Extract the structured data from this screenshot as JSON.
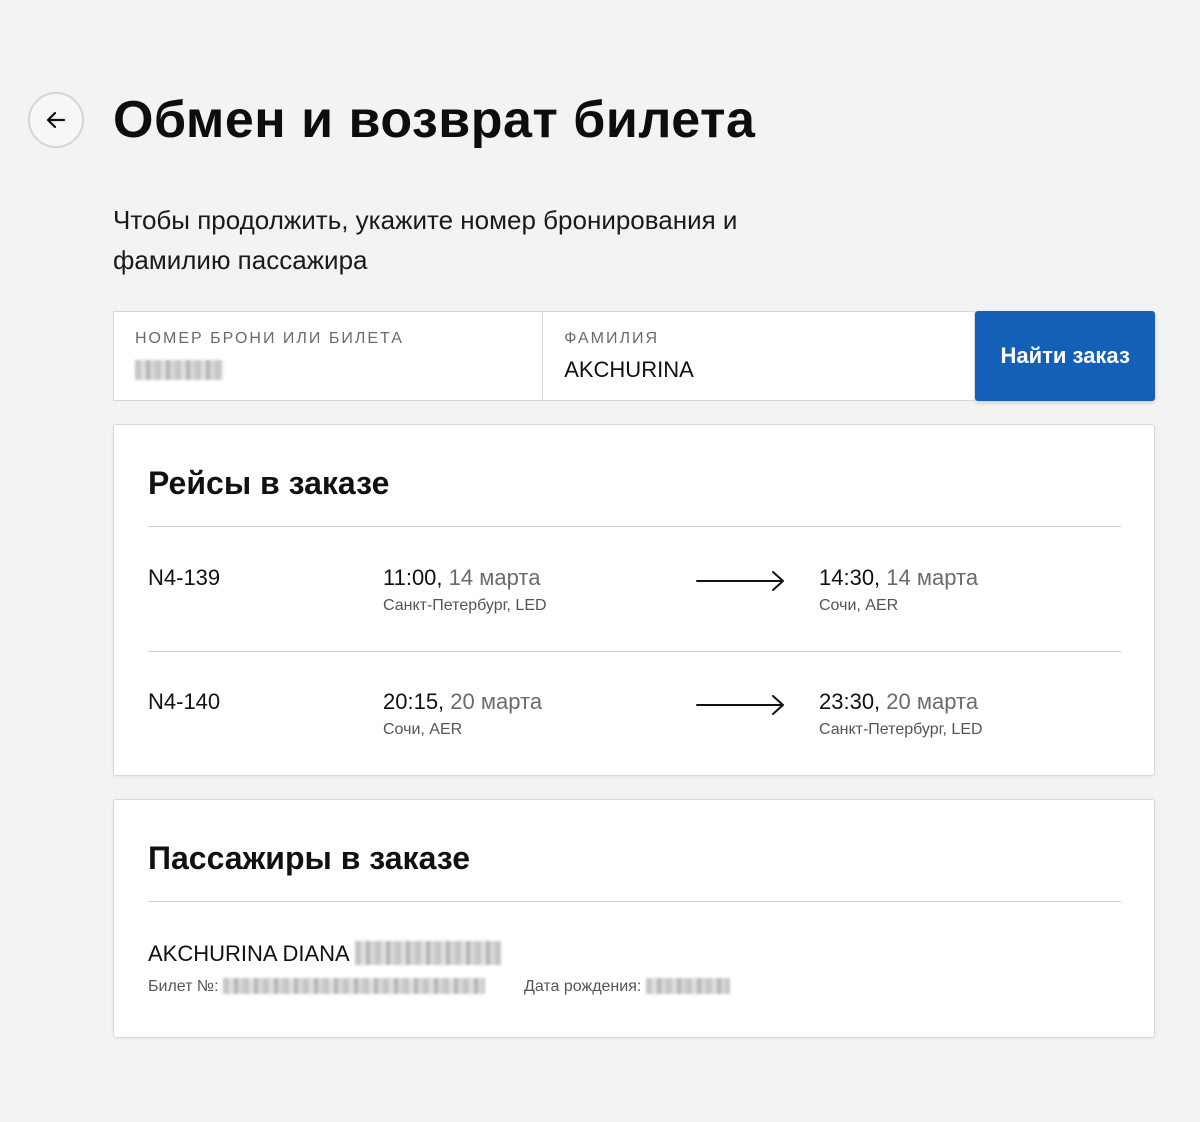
{
  "page": {
    "title": "Обмен и возврат билета",
    "intro": "Чтобы продолжить, укажите номер бронирования и фамилию пассажира"
  },
  "icons": {
    "back": "arrow-left-icon",
    "flight_arrow": "arrow-right-icon"
  },
  "search": {
    "booking_label": "НОМЕР БРОНИ ИЛИ БИЛЕТА",
    "booking_value": "",
    "surname_label": "ФАМИЛИЯ",
    "surname_value": "AKCHURINA",
    "find_button": "Найти заказ"
  },
  "colors": {
    "accent": "#1460b8",
    "background": "#f3f3f3"
  },
  "flights": {
    "title": "Рейсы в заказе",
    "items": [
      {
        "number": "N4-139",
        "dep_time": "11:00,",
        "dep_date": "14 марта",
        "dep_place": "Санкт-Петербург, LED",
        "arr_time": "14:30,",
        "arr_date": "14 марта",
        "arr_place": "Сочи, AER"
      },
      {
        "number": "N4-140",
        "dep_time": "20:15,",
        "dep_date": "20 марта",
        "dep_place": "Сочи, AER",
        "arr_time": "23:30,",
        "arr_date": "20 марта",
        "arr_place": "Санкт-Петербург, LED"
      }
    ]
  },
  "passengers": {
    "title": "Пассажиры в заказе",
    "items": [
      {
        "name": "AKCHURINA DIANA",
        "ticket_label": "Билет №:",
        "dob_label": "Дата рождения:"
      }
    ]
  }
}
